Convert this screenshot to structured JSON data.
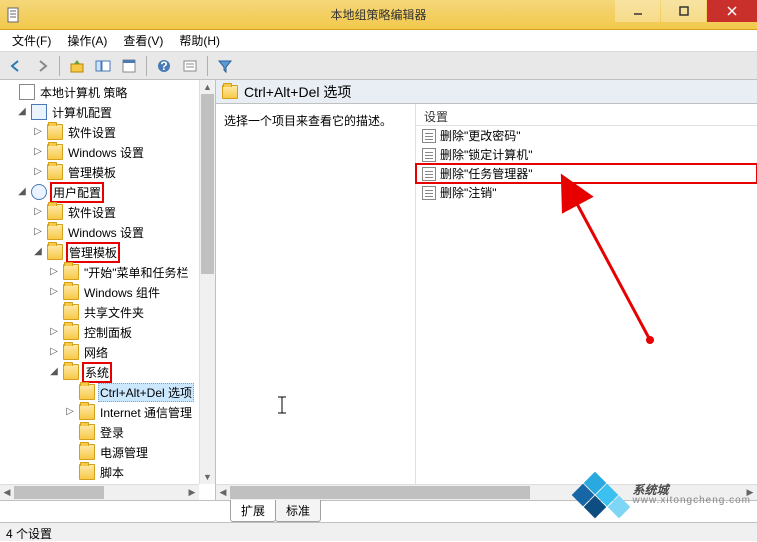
{
  "window": {
    "title": "本地组策略编辑器"
  },
  "menu": {
    "file": "文件(F)",
    "action": "操作(A)",
    "view": "查看(V)",
    "help": "帮助(H)"
  },
  "tree": {
    "root": "本地计算机 策略",
    "computer_config": "计算机配置",
    "cc_software": "软件设置",
    "cc_windows": "Windows 设置",
    "cc_templates": "管理模板",
    "user_config": "用户配置",
    "uc_software": "软件设置",
    "uc_windows": "Windows 设置",
    "uc_templates": "管理模板",
    "start_taskbar": "\"开始\"菜单和任务栏",
    "win_components": "Windows 组件",
    "shared_folders": "共享文件夹",
    "control_panel": "控制面板",
    "network": "网络",
    "system": "系统",
    "ctrl_alt_del": "Ctrl+Alt+Del 选项",
    "internet_comm": "Internet 通信管理",
    "logon": "登录",
    "power_mgmt": "电源管理",
    "scripts": "脚本"
  },
  "content": {
    "header": "Ctrl+Alt+Del 选项",
    "desc_prompt": "选择一个项目来查看它的描述。",
    "col_setting": "设置",
    "items": [
      "删除\"更改密码\"",
      "删除\"锁定计算机\"",
      "删除\"任务管理器\"",
      "删除\"注销\""
    ]
  },
  "tabs": {
    "extended": "扩展",
    "standard": "标准"
  },
  "statusbar": {
    "text": "4 个设置"
  },
  "watermark": {
    "name": "系统城",
    "url": "www.xitongcheng.com"
  }
}
